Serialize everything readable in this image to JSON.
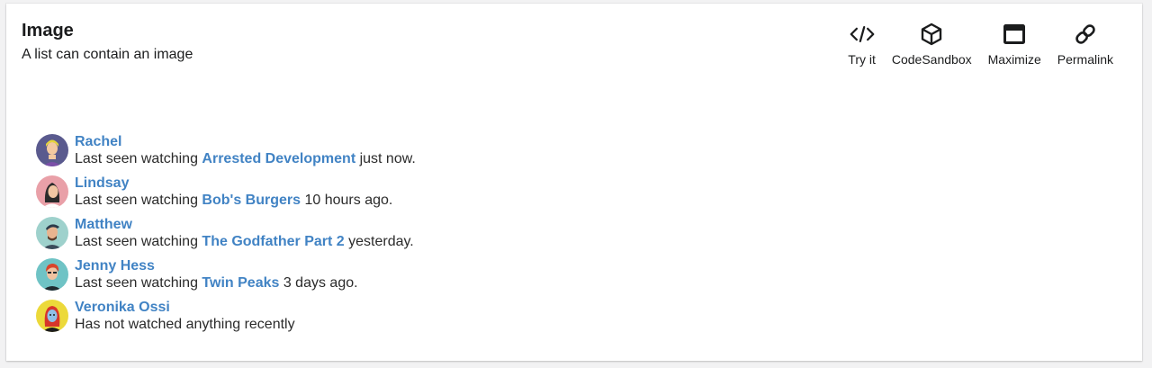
{
  "header": {
    "title": "Image",
    "subtitle": "A list can contain an image"
  },
  "actions": [
    {
      "label": "Try it",
      "icon": "code-icon"
    },
    {
      "label": "CodeSandbox",
      "icon": "cube-icon"
    },
    {
      "label": "Maximize",
      "icon": "window-maximize-icon"
    },
    {
      "label": "Permalink",
      "icon": "link-icon"
    }
  ],
  "colors": {
    "link": "#4183c4",
    "text": "#1b1c1d",
    "background": "#f2f2f3"
  },
  "list": [
    {
      "name": "Rachel",
      "prefix": "Last seen watching ",
      "show": "Arrested Development",
      "suffix": " just now."
    },
    {
      "name": "Lindsay",
      "prefix": "Last seen watching ",
      "show": "Bob's Burgers",
      "suffix": " 10 hours ago."
    },
    {
      "name": "Matthew",
      "prefix": "Last seen watching ",
      "show": "The Godfather Part 2",
      "suffix": " yesterday."
    },
    {
      "name": "Jenny Hess",
      "prefix": "Last seen watching ",
      "show": "Twin Peaks",
      "suffix": " 3 days ago."
    },
    {
      "name": "Veronika Ossi",
      "prefix": "Has not watched anything recently",
      "show": "",
      "suffix": ""
    }
  ]
}
